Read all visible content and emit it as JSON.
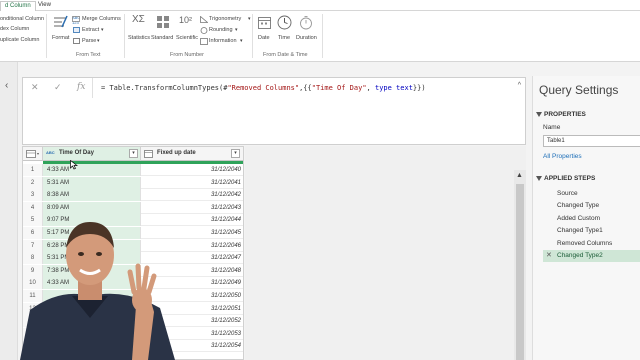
{
  "ribbon": {
    "tabs": [
      {
        "label": "d Column",
        "active": true
      },
      {
        "label": "View",
        "active": false
      }
    ],
    "left_items": [
      "onditional Column",
      "dex Column",
      "uplicate Column"
    ],
    "text_group": {
      "format": "Format",
      "merge": "Merge Columns",
      "extract": "Extract",
      "parse": "Parse",
      "label": "From Text",
      "abc": "ABC",
      "num": "123"
    },
    "number_group": {
      "statistics": "Statistics",
      "standard": "Standard",
      "scientific": "Scientific",
      "trig": "Trigonometry",
      "rounding": "Rounding",
      "information": "Information",
      "label": "From Number",
      "sigma": "XΣ",
      "exp": "10²"
    },
    "datetime_group": {
      "date": "Date",
      "time": "Time",
      "duration": "Duration",
      "label": "From Date & Time"
    }
  },
  "formula": {
    "prefix": "= Table.TransformColumnTypes(#",
    "s1": "\"Removed Columns\"",
    "mid": ",{{",
    "s2": "\"Time Of Day\"",
    "mid2": ", ",
    "kw": "type text",
    "suffix": "}})",
    "icons": [
      "close-icon",
      "check-icon",
      "fx-icon"
    ]
  },
  "grid": {
    "col1": "Time Of Day",
    "col2": "Fixed up date",
    "type_abc": "ABC",
    "type_123": "123",
    "rows": [
      {
        "idx": "1",
        "time": "4:33 AM",
        "date": "31/12/2040"
      },
      {
        "idx": "2",
        "time": "5:31 AM",
        "date": "31/12/2041"
      },
      {
        "idx": "3",
        "time": "8:38 AM",
        "date": "31/12/2042"
      },
      {
        "idx": "4",
        "time": "8:09 AM",
        "date": "31/12/2043"
      },
      {
        "idx": "5",
        "time": "9:07 PM",
        "date": "31/12/2044"
      },
      {
        "idx": "6",
        "time": "5:17 PM",
        "date": "31/12/2045"
      },
      {
        "idx": "7",
        "time": "6:28 PM",
        "date": "31/12/2046"
      },
      {
        "idx": "8",
        "time": "5:31 PM",
        "date": "31/12/2047"
      },
      {
        "idx": "9",
        "time": "7:38 PM",
        "date": "31/12/2048"
      },
      {
        "idx": "10",
        "time": "4:33 AM",
        "date": "31/12/2049"
      },
      {
        "idx": "11",
        "time": "",
        "date": "31/12/2050"
      },
      {
        "idx": "12",
        "time": "",
        "date": "31/12/2051"
      },
      {
        "idx": "13",
        "time": "",
        "date": "31/12/2052"
      },
      {
        "idx": "14",
        "time": "",
        "date": "31/12/2053"
      },
      {
        "idx": "15",
        "time": "",
        "date": "31/12/2054"
      }
    ]
  },
  "query_settings": {
    "title": "Query Settings",
    "properties": "PROPERTIES",
    "name_label": "Name",
    "name_value": "Table1",
    "all_properties": "All Properties",
    "applied_steps": "APPLIED STEPS",
    "steps": [
      {
        "label": "Source",
        "selected": false
      },
      {
        "label": "Changed Type",
        "selected": false
      },
      {
        "label": "Added Custom",
        "selected": false
      },
      {
        "label": "Changed Type1",
        "selected": false
      },
      {
        "label": "Removed Columns",
        "selected": false
      },
      {
        "label": "Changed Type2",
        "selected": true
      }
    ]
  },
  "colors": {
    "accent": "#217346",
    "selected_column": "#dff0e4",
    "selected_step": "#cfe6d6",
    "quality_bar": "#2fa35a"
  }
}
